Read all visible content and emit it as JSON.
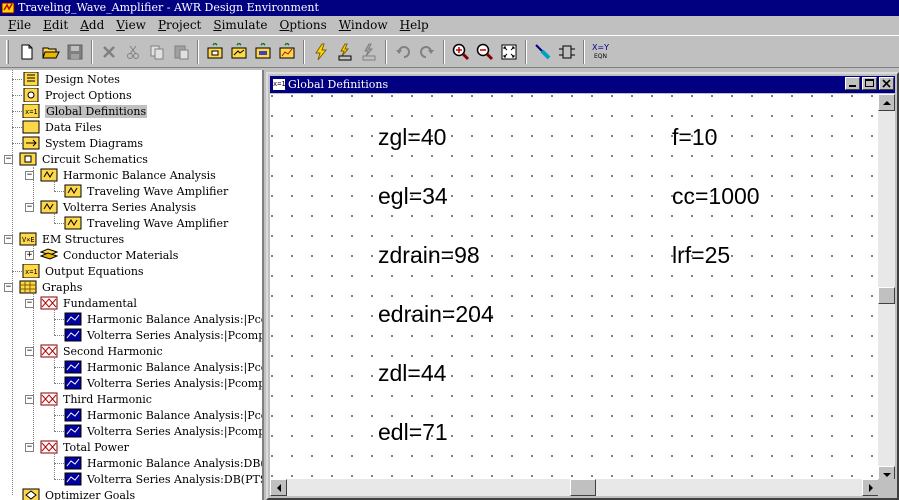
{
  "window": {
    "title": "Traveling_Wave_Amplifier - AWR Design Environment"
  },
  "menu": [
    {
      "label": "File",
      "key": "F",
      "rest": "ile"
    },
    {
      "label": "Edit",
      "key": "E",
      "rest": "dit"
    },
    {
      "label": "Add",
      "key": "A",
      "rest": "dd"
    },
    {
      "label": "View",
      "key": "V",
      "rest": "iew"
    },
    {
      "label": "Project",
      "key": "P",
      "rest": "roject"
    },
    {
      "label": "Simulate",
      "key": "S",
      "rest": "imulate"
    },
    {
      "label": "Options",
      "key": "O",
      "rest": "ptions"
    },
    {
      "label": "Window",
      "key": "W",
      "rest": "indow"
    },
    {
      "label": "Help",
      "key": "H",
      "rest": "elp"
    }
  ],
  "toolbar": {
    "eqn_label_top": "X=Y",
    "eqn_label_bottom": "EQN"
  },
  "tree": {
    "design_notes": "Design Notes",
    "project_options": "Project Options",
    "global_definitions": "Global Definitions",
    "data_files": "Data Files",
    "system_diagrams": "System Diagrams",
    "circuit_schematics": "Circuit Schematics",
    "hb_analysis": "Harmonic Balance Analysis",
    "hb_twa": "Traveling Wave Amplifier",
    "volterra_analysis": "Volterra Series Analysis",
    "volterra_twa": "Traveling Wave Amplifier",
    "em_structures": "EM Structures",
    "conductor_materials": "Conductor Materials",
    "output_equations": "Output Equations",
    "graphs": "Graphs",
    "fundamental": "Fundamental",
    "fund_hb": "Harmonic Balance Analysis:|Pcomp",
    "fund_vs": "Volterra Series Analysis:|PcompSP[P",
    "second_harmonic": "Second Harmonic",
    "second_hb": "Harmonic Balance Analysis:|Pcomp",
    "second_vs": "Volterra Series Analysis:|PcompSP[P",
    "third_harmonic": "Third Harmonic",
    "third_hb": "Harmonic Balance Analysis:|Pcomp",
    "third_vs": "Volterra Series Analysis:|PcompSP[P",
    "total_power": "Total Power",
    "total_hb": "Harmonic Balance Analysis:DB(PT:",
    "total_vs": "Volterra Series Analysis:DB(PTSP[P",
    "optimizer_goals": "Optimizer Goals"
  },
  "doc_window": {
    "title": "Global Definitions",
    "icon_text": "x=1"
  },
  "equations": {
    "zgl": "zgl=40",
    "egl": "egl=34",
    "zdrain": "zdrain=98",
    "edrain": "edrain=204",
    "zdl": "zdl=44",
    "edl": "edl=71",
    "f": "f=10",
    "cc": "cc=1000",
    "lrf": "lrf=25"
  }
}
